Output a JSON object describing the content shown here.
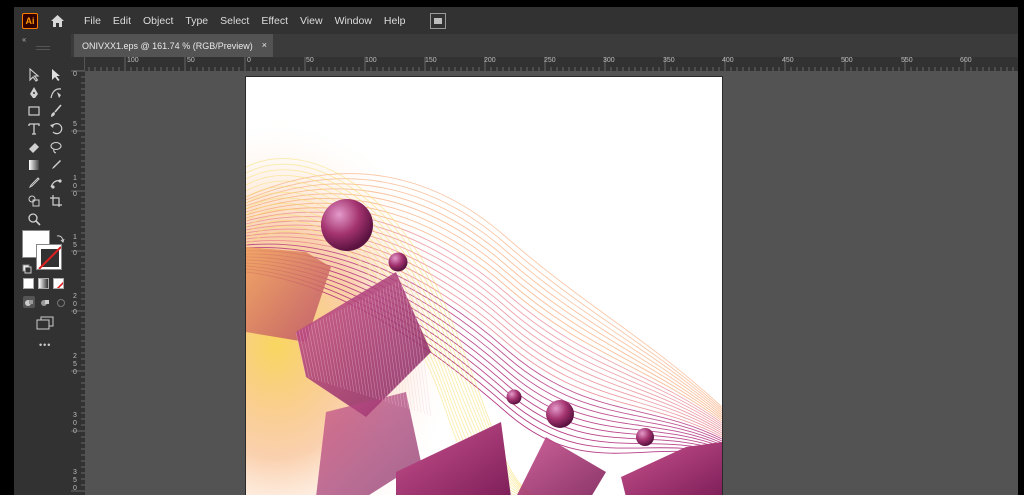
{
  "app": {
    "logo_text": "Ai"
  },
  "menubar": {
    "items": [
      "File",
      "Edit",
      "Object",
      "Type",
      "Select",
      "Effect",
      "View",
      "Window",
      "Help"
    ]
  },
  "document": {
    "tab_label": "ONIVXX1.eps @ 161.74 % (RGB/Preview)",
    "close_glyph": "×"
  },
  "toolbar": {
    "collapse_glyph": "‹‹",
    "tools": [
      "selection-tool",
      "direct-selection-tool",
      "pen-tool",
      "curvature-tool",
      "rectangle-tool",
      "paintbrush-tool",
      "type-tool",
      "rotate-tool",
      "eraser-tool",
      "lasso-tool",
      "gradient-tool",
      "eyedropper-tool",
      "width-tool",
      "blend-tool",
      "shape-builder-tool",
      "artboard-tool",
      "zoom-tool"
    ],
    "more_glyph": "•••"
  },
  "ruler_top": {
    "labels": [
      "100",
      "50",
      "0",
      "50",
      "100",
      "150",
      "200",
      "250",
      "300",
      "350",
      "400",
      "450",
      "500",
      "550",
      "600"
    ]
  },
  "ruler_left": {
    "labels": [
      "0",
      "5 0",
      "1 0 0",
      "1 5 0",
      "2 0 0",
      "2 5 0",
      "3 0 0",
      "3 5 0"
    ]
  },
  "colors": {
    "accent": "#ff9a00",
    "panel": "#323232",
    "canvas": "#535353",
    "art_magenta": "#b3337f",
    "art_orange": "#f59b62",
    "art_yellow": "#f6e06a"
  }
}
